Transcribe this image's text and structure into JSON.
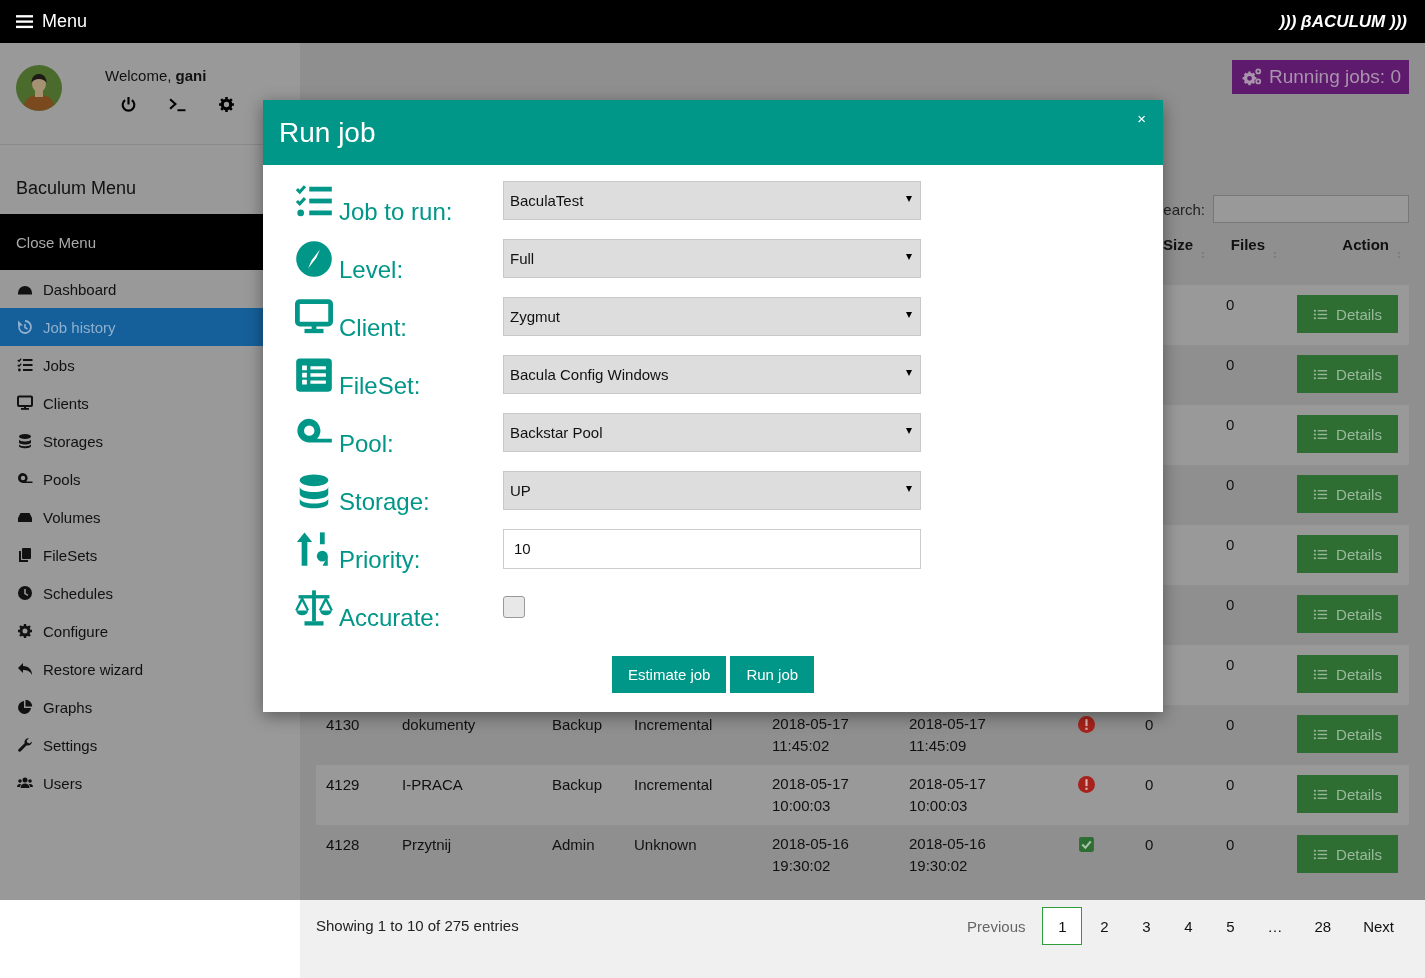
{
  "topbar": {
    "menu_label": "Menu",
    "logo": "))) βACULUM )))"
  },
  "user": {
    "welcome": "Welcome, **gani**"
  },
  "sidebar": {
    "title": "Baculum Menu",
    "close_label": "Close Menu",
    "items": [
      {
        "label": "Dashboard",
        "selected": false
      },
      {
        "label": "Job history",
        "selected": true
      },
      {
        "label": "Jobs",
        "selected": false
      },
      {
        "label": "Clients",
        "selected": false
      },
      {
        "label": "Storages",
        "selected": false
      },
      {
        "label": "Pools",
        "selected": false
      },
      {
        "label": "Volumes",
        "selected": false
      },
      {
        "label": "FileSets",
        "selected": false
      },
      {
        "label": "Schedules",
        "selected": false
      },
      {
        "label": "Configure",
        "selected": false
      },
      {
        "label": "Restore wizard",
        "selected": false
      },
      {
        "label": "Graphs",
        "selected": false
      },
      {
        "label": "Settings",
        "selected": false
      },
      {
        "label": "Users",
        "selected": false
      }
    ]
  },
  "running_jobs": "Running jobs: 0",
  "search": {
    "label": "earch:"
  },
  "table": {
    "header": [
      {
        "label": "Size"
      },
      {
        "label": "Files"
      },
      {
        "label": "Action"
      }
    ],
    "rows": [
      {
        "files": "0",
        "action": "Details"
      },
      {
        "files": "0",
        "action": "Details"
      },
      {
        "files": "0",
        "action": "Details"
      },
      {
        "files": "0",
        "action": "Details"
      },
      {
        "files": "0",
        "action": "Details"
      },
      {
        "files": "0",
        "action": "Details"
      },
      {
        "files": "0",
        "action": "Details"
      },
      {
        "id": "4130",
        "name": "dokumenty",
        "type": "Backup",
        "level": "Incremental",
        "start": "2018-05-17 11:45:02",
        "end": "2018-05-17 11:45:09",
        "kind": "error",
        "size": "0",
        "files": "0",
        "action": "Details"
      },
      {
        "id": "4129",
        "name": "I-PRACA",
        "type": "Backup",
        "level": "Incremental",
        "start": "2018-05-17 10:00:03",
        "end": "2018-05-17 10:00:03",
        "kind": "error",
        "size": "0",
        "files": "0",
        "action": "Details"
      },
      {
        "id": "4128",
        "name": "Przytnij",
        "type": "Admin",
        "level": "Unknown",
        "start": "2018-05-16 19:30:02",
        "end": "2018-05-16 19:30:02",
        "kind": "ok",
        "size": "0",
        "files": "0",
        "action": "Details"
      }
    ]
  },
  "footer": {
    "info": "Showing 1 to 10 of 275 entries",
    "pagination": [
      {
        "label": "Previous",
        "selected": false,
        "disabled": true
      },
      {
        "label": "1",
        "selected": true,
        "disabled": false
      },
      {
        "label": "2",
        "selected": false,
        "disabled": false
      },
      {
        "label": "3",
        "selected": false,
        "disabled": false
      },
      {
        "label": "4",
        "selected": false,
        "disabled": false
      },
      {
        "label": "5",
        "selected": false,
        "disabled": false
      },
      {
        "label": "…",
        "selected": false,
        "disabled": false
      },
      {
        "label": "28",
        "selected": false,
        "disabled": false
      },
      {
        "label": "Next",
        "selected": false,
        "disabled": false
      }
    ]
  },
  "modal": {
    "title": "Run job",
    "close": "×",
    "fields": [
      {
        "kind": "select",
        "label": "Job to run:",
        "value": "BaculaTest"
      },
      {
        "kind": "select",
        "label": "Level:",
        "value": "Full"
      },
      {
        "kind": "select",
        "label": "Client:",
        "value": "Zygmut"
      },
      {
        "kind": "select",
        "label": "FileSet:",
        "value": "Bacula Config Windows"
      },
      {
        "kind": "select",
        "label": "Pool:",
        "value": "Backstar Pool"
      },
      {
        "kind": "select",
        "label": "Storage:",
        "value": "UP"
      },
      {
        "kind": "text",
        "label": "Priority:",
        "value": "10"
      },
      {
        "kind": "checkbox",
        "label": "Accurate:",
        "checked": false
      }
    ],
    "buttons": [
      "Estimate job",
      "Run job"
    ]
  }
}
